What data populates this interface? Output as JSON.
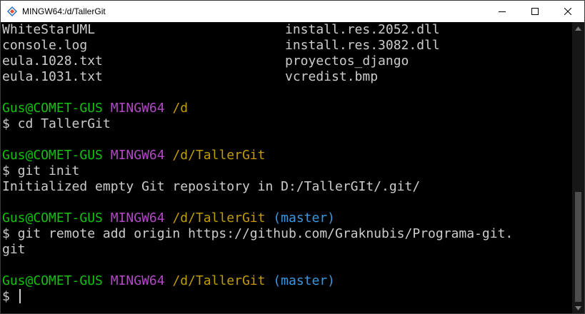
{
  "window": {
    "title": "MINGW64:/d/TallerGit",
    "app_icon": "mingw-diamond-icon",
    "buttons": {
      "minimize": "minimize-icon",
      "maximize": "maximize-icon",
      "close": "close-icon"
    }
  },
  "colors": {
    "user_host": "#13c10e",
    "mingw": "#b148c6",
    "path": "#c19c00",
    "branch": "#3a96dd",
    "text": "#cccccc",
    "background": "#000000"
  },
  "terminal": {
    "ls_rows": [
      {
        "left": "WhiteStarUML",
        "right": "install.res.2052.dll"
      },
      {
        "left": "console.log",
        "right": "install.res.3082.dll"
      },
      {
        "left": "eula.1028.txt",
        "right": "proyectos_django"
      },
      {
        "left": "eula.1031.txt",
        "right": "vcredist.bmp"
      }
    ],
    "prompts": [
      {
        "user": "Gus@COMET-GUS",
        "env": "MINGW64",
        "path": "/d",
        "branch": "",
        "command": "$ cd TallerGit",
        "output": []
      },
      {
        "user": "Gus@COMET-GUS",
        "env": "MINGW64",
        "path": "/d/TallerGit",
        "branch": "",
        "command": "$ git init",
        "output": [
          "Initialized empty Git repository in D:/TallerGIt/.git/"
        ]
      },
      {
        "user": "Gus@COMET-GUS",
        "env": "MINGW64",
        "path": "/d/TallerGit",
        "branch": "(master)",
        "command": "$ git remote add origin https://github.com/Graknubis/Programa-git.",
        "output": [
          "git"
        ]
      },
      {
        "user": "Gus@COMET-GUS",
        "env": "MINGW64",
        "path": "/d/TallerGit",
        "branch": "(master)",
        "command": "$ ",
        "output": []
      }
    ]
  }
}
